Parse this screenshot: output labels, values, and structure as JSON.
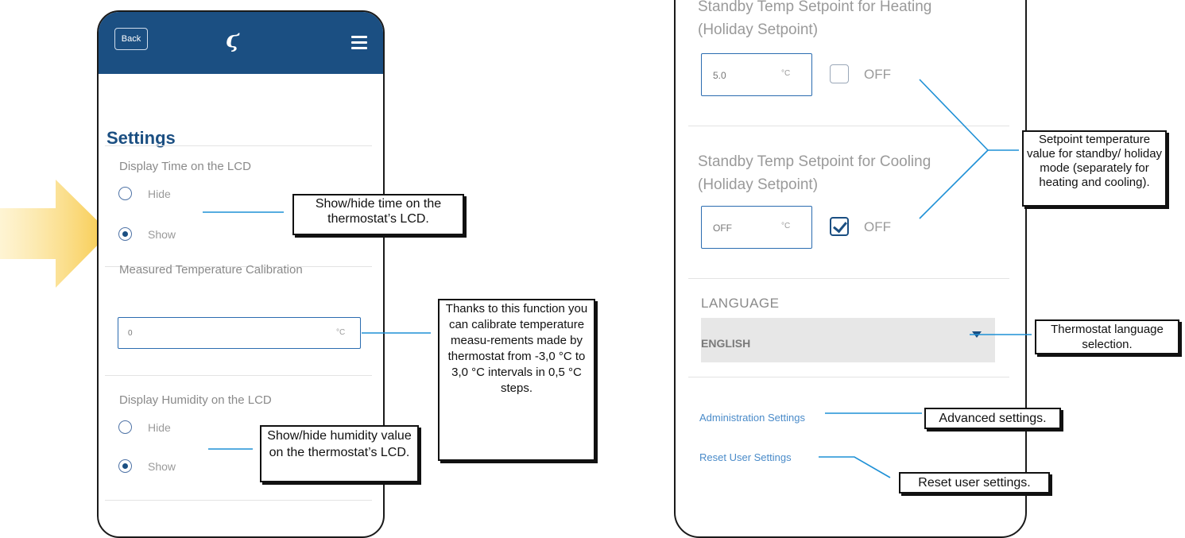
{
  "colors": {
    "appbar": "#1b4f82",
    "title": "#1b4f82",
    "link": "#4a8bc9",
    "leader_line": "#1e90d6",
    "arrow_yellow": "#f7c948"
  },
  "left_screen": {
    "back_label": "Back",
    "logo_icon": "salus-logo-icon",
    "menu_icon": "hamburger-menu-icon",
    "title": "Settings",
    "display_time": {
      "label": "Display Time on the LCD",
      "options": [
        "Hide",
        "Show"
      ],
      "selected": "Show"
    },
    "calibration": {
      "label": "Measured Temperature Calibration",
      "value": "0",
      "unit": "°C"
    },
    "display_humidity": {
      "label": "Display Humidity on the LCD",
      "options": [
        "Hide",
        "Show"
      ],
      "selected": "Show"
    }
  },
  "right_screen": {
    "heating": {
      "label_line1": "Standby Temp Setpoint for Heating",
      "label_line2": "(Holiday Setpoint)",
      "value": "5.0",
      "unit": "°C",
      "off_label": "OFF",
      "off_checked": false
    },
    "cooling": {
      "label_line1": "Standby Temp Setpoint for Cooling",
      "label_line2": "(Holiday Setpoint)",
      "value": "OFF",
      "unit": "°C",
      "off_label": "OFF",
      "off_checked": true
    },
    "language": {
      "label": "LANGUAGE",
      "selected": "ENGLISH"
    },
    "admin_link": "Administration Settings",
    "reset_link": "Reset User Settings"
  },
  "callouts": {
    "time": "Show/hide time on the thermostat’s LCD.",
    "calibration": "Thanks to this function you can calibrate temperature measu-rements made by thermostat from -3,0 °C to 3,0 °C intervals in 0,5 °C steps.",
    "humidity": "Show/hide humidity value on the thermostat’s LCD.",
    "setpoint": "Setpoint temperature value for standby/ holiday mode (separately for heating and cooling).",
    "language": "Thermostat language selection.",
    "advanced": "Advanced settings.",
    "reset": "Reset user settings."
  }
}
